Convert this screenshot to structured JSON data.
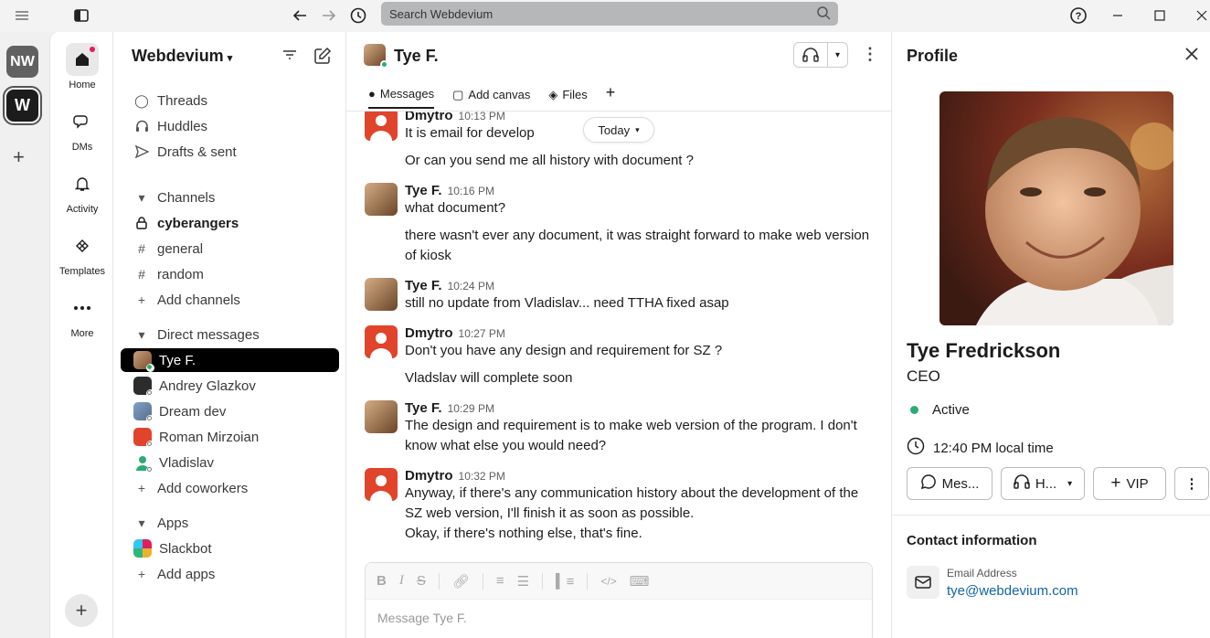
{
  "titlebar": {
    "search_placeholder": "Search Webdevium"
  },
  "workspaces": [
    {
      "abbr": "NW"
    },
    {
      "abbr": "W"
    }
  ],
  "nav": [
    {
      "label": "Home"
    },
    {
      "label": "DMs"
    },
    {
      "label": "Activity"
    },
    {
      "label": "Templates"
    },
    {
      "label": "More"
    }
  ],
  "sidebar": {
    "workspace_name": "Webdevium",
    "top": [
      "Threads",
      "Huddles",
      "Drafts & sent"
    ],
    "channels_header": "Channels",
    "channels": [
      "cyberangers",
      "general",
      "random"
    ],
    "add_channels": "Add channels",
    "dm_header": "Direct messages",
    "dms": [
      "Tye F.",
      "Andrey Glazkov",
      "Dream dev",
      "Roman Mirzoian",
      "Vladislav"
    ],
    "add_coworkers": "Add coworkers",
    "apps_header": "Apps",
    "apps": [
      "Slackbot"
    ],
    "add_apps": "Add apps"
  },
  "conversation": {
    "title": "Tye F.",
    "tabs": [
      "Messages",
      "Add canvas",
      "Files"
    ],
    "date_pill": "Today",
    "messages": [
      {
        "author": "Dmytro",
        "time": "10:13 PM",
        "lines": [
          "It is email for develop",
          "Or can you send me all history with document ?"
        ]
      },
      {
        "author": "Tye F.",
        "time": "10:16 PM",
        "lines": [
          "what document?",
          "there wasn't ever any document, it was straight forward to make web version of kiosk"
        ]
      },
      {
        "author": "Tye F.",
        "time": "10:24 PM",
        "lines": [
          "still no update from Vladislav... need TTHA fixed asap"
        ]
      },
      {
        "author": "Dmytro",
        "time": "10:27 PM",
        "lines": [
          "Don't you have any design and requirement for SZ ?",
          "Vladslav will complete soon"
        ]
      },
      {
        "author": "Tye F.",
        "time": "10:29 PM",
        "lines": [
          "The design and requirement is to make web version of the program. I don't know what else you would need?"
        ]
      },
      {
        "author": "Dmytro",
        "time": "10:32 PM",
        "lines": [
          "Anyway, if there's any communication history about the development of the SZ web version, I'll finish it as soon as possible.",
          "Okay, if there's nothing else, that's fine."
        ]
      }
    ],
    "composer_placeholder": "Message Tye F."
  },
  "profile": {
    "header": "Profile",
    "name": "Tye Fredrickson",
    "role": "CEO",
    "status": "Active",
    "local_time": "12:40 PM local time",
    "buttons": [
      "Mes...",
      "H...",
      "VIP"
    ],
    "contact_header": "Contact information",
    "email_label": "Email Address",
    "email": "tye@webdevium.com"
  },
  "colors": {
    "presence": "#2bac76",
    "link": "#1264a3",
    "dmytro_avatar": "#e0442b"
  }
}
